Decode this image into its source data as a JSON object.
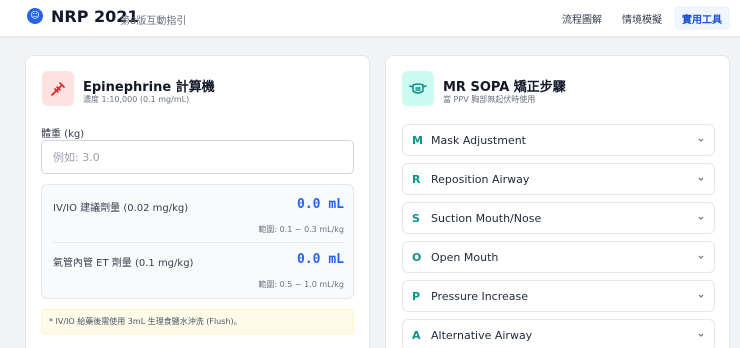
{
  "header": {
    "logo_glyph": "☺",
    "title": "NRP 2021",
    "subtitle": "第8版互動指引",
    "nav": [
      {
        "label": "流程圖解",
        "active": false
      },
      {
        "label": "情境模擬",
        "active": false
      },
      {
        "label": "實用工具",
        "active": true
      }
    ]
  },
  "epinephrine": {
    "icon": "syringe-icon",
    "title": "Epinephrine 計算機",
    "subtitle": "濃度 1:10,000 (0.1 mg/mL)",
    "weight_label": "體重 (kg)",
    "weight_placeholder": "例如: 3.0",
    "weight_value": "",
    "doses": [
      {
        "label": "IV/IO 建議劑量 (0.02 mg/kg)",
        "value": "0.0 mL",
        "range": "範圍: 0.1 ~ 0.3 mL/kg"
      },
      {
        "label": "氣管內管 ET 劑量 (0.1 mg/kg)",
        "value": "0.0 mL",
        "range": "範圍: 0.5 ~ 1.0 mL/kg"
      }
    ],
    "note": "* IV/IO 給藥後需使用 3mL 生理食鹽水沖洗 (Flush)。"
  },
  "mrsopa": {
    "icon": "mask-icon",
    "title": "MR SOPA 矯正步驟",
    "subtitle": "當 PPV 胸部無起伏時使用",
    "steps": [
      {
        "letter": "M",
        "label": "Mask Adjustment"
      },
      {
        "letter": "R",
        "label": "Reposition Airway"
      },
      {
        "letter": "S",
        "label": "Suction Mouth/Nose"
      },
      {
        "letter": "O",
        "label": "Open Mouth"
      },
      {
        "letter": "P",
        "label": "Pressure Increase"
      },
      {
        "letter": "A",
        "label": "Alternative Airway"
      }
    ]
  },
  "colors": {
    "accent": "#2563eb",
    "teal": "#0d9488",
    "danger": "#dc2626"
  }
}
